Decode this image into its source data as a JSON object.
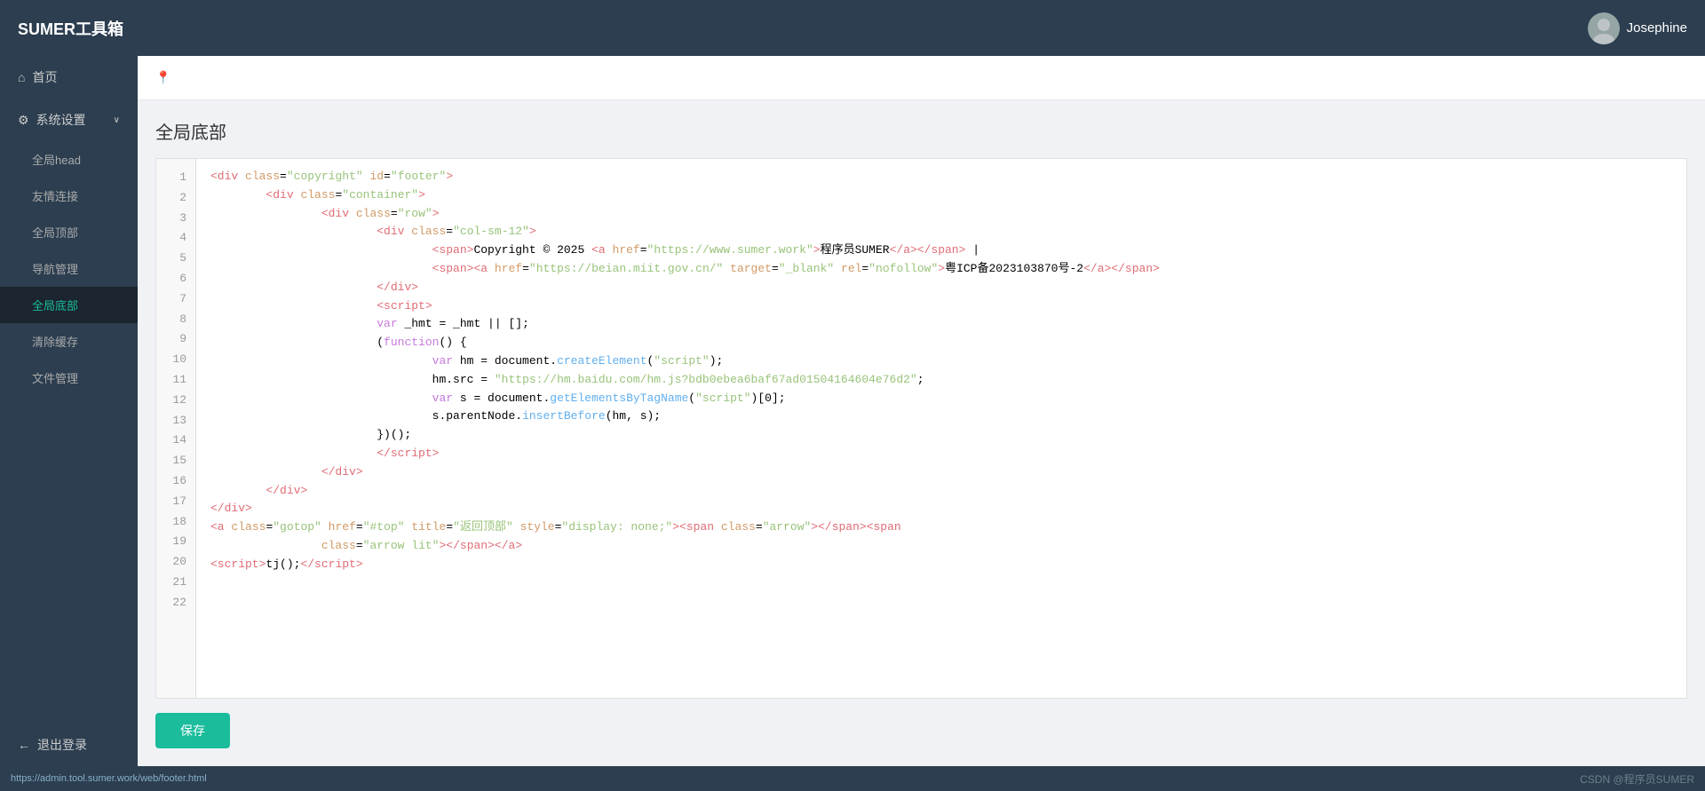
{
  "header": {
    "logo": "SUMER工具箱",
    "username": "Josephine",
    "location_icon": "📍"
  },
  "sidebar": {
    "items": [
      {
        "id": "home",
        "label": "首页",
        "icon": "⌂",
        "active": false
      },
      {
        "id": "settings",
        "label": "系统设置",
        "icon": "⚙",
        "active": false,
        "expanded": true,
        "arrow": "∨"
      },
      {
        "id": "global-head",
        "label": "全局head",
        "active": false,
        "sub": true
      },
      {
        "id": "friendlinks",
        "label": "友情连接",
        "active": false,
        "sub": true
      },
      {
        "id": "global-top",
        "label": "全局顶部",
        "active": false,
        "sub": true
      },
      {
        "id": "nav-manage",
        "label": "导航管理",
        "active": false,
        "sub": true
      },
      {
        "id": "global-footer",
        "label": "全局底部",
        "active": true,
        "sub": true
      },
      {
        "id": "clear-cache",
        "label": "清除缓存",
        "active": false,
        "sub": true
      },
      {
        "id": "file-manage",
        "label": "文件管理",
        "active": false,
        "sub": true
      }
    ],
    "logout": {
      "label": "退出登录",
      "icon": "←"
    }
  },
  "page": {
    "title": "全局底部",
    "breadcrumb_icon": "📍"
  },
  "code": {
    "lines": [
      {
        "num": 1,
        "html": "<span class='tag'>&lt;div</span> <span class='attr-name'>class</span>=<span class='attr-value'>\"copyright\"</span> <span class='attr-name'>id</span>=<span class='attr-value'>\"footer\"</span><span class='tag'>&gt;</span>"
      },
      {
        "num": 2,
        "html": "        <span class='tag'>&lt;div</span> <span class='attr-name'>class</span>=<span class='attr-value'>\"container\"</span><span class='tag'>&gt;</span>"
      },
      {
        "num": 3,
        "html": "                <span class='tag'>&lt;div</span> <span class='attr-name'>class</span>=<span class='attr-value'>\"row\"</span><span class='tag'>&gt;</span>"
      },
      {
        "num": 4,
        "html": "                        <span class='tag'>&lt;div</span> <span class='attr-name'>class</span>=<span class='attr-value'>\"col-sm-12\"</span><span class='tag'>&gt;</span>"
      },
      {
        "num": 5,
        "html": "                                <span class='tag'>&lt;span&gt;</span>Copyright © 2025 <span class='tag'>&lt;a</span> <span class='attr-name'>href</span>=<span class='attr-value'>\"https://www.sumer.work\"</span><span class='tag'>&gt;</span>程序员SUMER<span class='tag'>&lt;/a&gt;&lt;/span&gt;</span> |"
      },
      {
        "num": 6,
        "html": "                                <span class='tag'>&lt;span&gt;&lt;a</span> <span class='attr-name'>href</span>=<span class='attr-value'>\"https://beian.miit.gov.cn/\"</span> <span class='attr-name'>target</span>=<span class='attr-value'>\"_blank\"</span> <span class='attr-name'>rel</span>=<span class='attr-value'>\"nofollow\"</span><span class='tag'>&gt;</span>粤ICP备2023103870号-2<span class='tag'>&lt;/a&gt;&lt;/span&gt;</span>"
      },
      {
        "num": 7,
        "html": "                        <span class='tag'>&lt;/div&gt;</span>"
      },
      {
        "num": 8,
        "html": "                        <span class='tag'>&lt;script&gt;</span>"
      },
      {
        "num": 9,
        "html": "                        <span class='keyword'>var</span> _hmt = _hmt || [];"
      },
      {
        "num": 10,
        "html": "                        (<span class='keyword'>function</span>() {"
      },
      {
        "num": 11,
        "html": "                                <span class='keyword'>var</span> hm = document.<span class='func'>createElement</span>(<span class='string-val'>\"script\"</span>);"
      },
      {
        "num": 12,
        "html": "                                hm.src = <span class='string-val'>\"https://hm.baidu.com/hm.js?bdb0ebea6baf67ad01504164604e76d2\"</span>;"
      },
      {
        "num": 13,
        "html": "                                <span class='keyword'>var</span> s = document.<span class='func'>getElementsByTagName</span>(<span class='string-val'>\"script\"</span>)[0];"
      },
      {
        "num": 14,
        "html": "                                s.parentNode.<span class='func'>insertBefore</span>(hm, s);"
      },
      {
        "num": 15,
        "html": "                        })();"
      },
      {
        "num": 16,
        "html": "                        <span class='tag'>&lt;/script&gt;</span>"
      },
      {
        "num": 17,
        "html": "                <span class='tag'>&lt;/div&gt;</span>"
      },
      {
        "num": 18,
        "html": "        <span class='tag'>&lt;/div&gt;</span>"
      },
      {
        "num": 19,
        "html": "<span class='tag'>&lt;/div&gt;</span>"
      },
      {
        "num": 20,
        "html": "<span class='tag'>&lt;a</span> <span class='attr-name'>class</span>=<span class='attr-value'>\"gotop\"</span> <span class='attr-name'>href</span>=<span class='attr-value'>\"#top\"</span> <span class='attr-name'>title</span>=<span class='attr-value'>\"返回顶部\"</span> <span class='attr-name'>style</span>=<span class='attr-value'>\"display: none;\"</span><span class='tag'>&gt;&lt;span</span> <span class='attr-name'>class</span>=<span class='attr-value'>\"arrow\"</span><span class='tag'>&gt;&lt;/span&gt;&lt;span</span>"
      },
      {
        "num": 21,
        "html": "                <span class='attr-name'>class</span>=<span class='attr-value'>\"arrow lit\"</span><span class='tag'>&gt;&lt;/span&gt;&lt;/a&gt;</span>"
      },
      {
        "num": 22,
        "html": "<span class='tag'>&lt;script&gt;</span>tj();<span class='tag'>&lt;/script&gt;</span>"
      }
    ]
  },
  "actions": {
    "save_label": "保存"
  },
  "status_bar": {
    "url": "https://admin.tool.sumer.work/web/footer.html",
    "brand": "CSDN @程序员SUMER"
  }
}
